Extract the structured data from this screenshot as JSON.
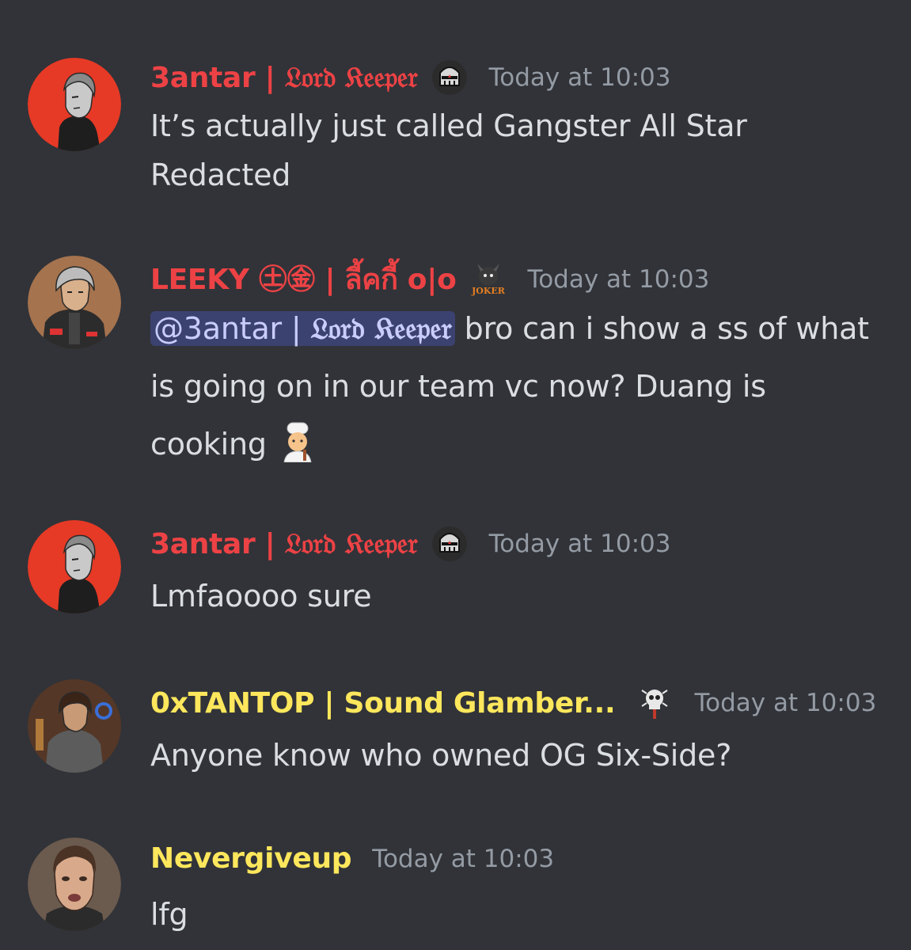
{
  "colors": {
    "background": "#313338",
    "red_role": "#ed4245",
    "yellow_role": "#fee75c",
    "timestamp": "#949ba4",
    "mention_bg": "#3c4270",
    "mention_text": "#c9cdfb"
  },
  "messages": [
    {
      "author_prefix": "3antar | ",
      "author_title": "𝔏𝔬𝔯𝔡 𝔎𝔢𝔢𝔭𝔢𝔯",
      "badge_icon": "knight-helmet-icon",
      "timestamp": "Today at 10:03",
      "text": "It’s actually just called Gangster All Star Redacted"
    },
    {
      "author": "LEEKY ㊏㊎ | ลี้คกี้ o|o",
      "badge_icon": "joker-badge-icon",
      "timestamp": "Today at 10:03",
      "mention_prefix": "@3antar | ",
      "mention_title": "𝔏𝔬𝔯𝔡 𝔎𝔢𝔢𝔭𝔢𝔯",
      "text": " bro can i show a ss of what is going on in our team vc now? Duang is cooking ",
      "emoji": "cook-emoji"
    },
    {
      "author_prefix": "3antar | ",
      "author_title": "𝔏𝔬𝔯𝔡 𝔎𝔢𝔢𝔭𝔢𝔯",
      "badge_icon": "knight-helmet-icon",
      "timestamp": "Today at 10:03",
      "text": "Lmfaoooo sure"
    },
    {
      "author": "0xTANTOP | Sound Glamber...",
      "badge_icon": "skull-badge-icon",
      "timestamp": "Today at 10:03",
      "text": "Anyone know who owned OG Six-Side?"
    },
    {
      "author": "Nevergiveup",
      "timestamp": "Today at 10:03",
      "text": "lfg"
    }
  ]
}
